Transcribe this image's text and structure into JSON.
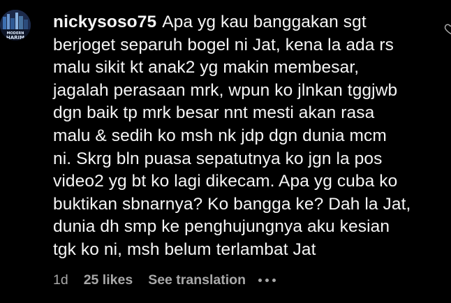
{
  "comment": {
    "username": "nickysoso75",
    "text": "Apa yg kau banggakan sgt\nberjoget separuh bogel ni Jat, kena la ada rs\nmalu sikit kt anak2 yg makin membesar,\njagalah perasaan mrk, wpun ko jlnkan tggjwb\ndgn baik tp mrk besar nnt mesti akan rasa\nmalu & sedih ko msh nk jdp dgn dunia mcm\nni. Skrg bln puasa sepatutnya ko jgn la pos\nvideo2 yg bt ko lagi dikecam. Apa yg cuba ko\nbuktikan sbnarnya? Ko bangga ke? Dah la Jat,\ndunia dh smp ke penghujungnya aku kesian\ntgk ko ni, msh belum terlambat Jat",
    "age": "1d",
    "likes": "25 likes",
    "translate_label": "See translation",
    "avatar_text": "MODERN HARIM"
  },
  "icons": {
    "more": "more-horizontal-icon",
    "like": "heart-outline-icon"
  },
  "colors": {
    "background": "#000000",
    "text": "#f5f5f5",
    "secondary": "#a8a8a8"
  }
}
